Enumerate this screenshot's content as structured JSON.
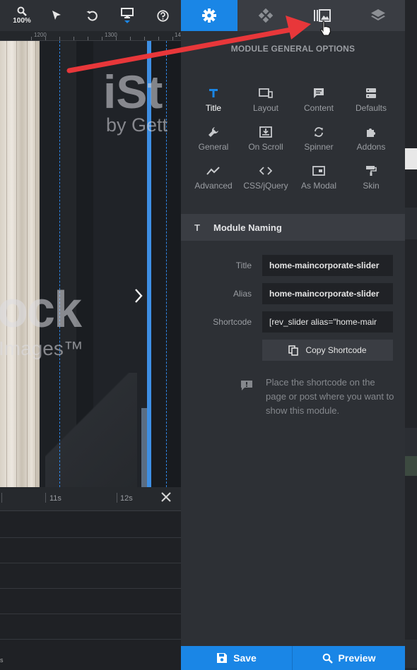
{
  "toolbar": {
    "zoom_label": "100%"
  },
  "ruler": {
    "labels": [
      "1200",
      "1300",
      "14"
    ]
  },
  "canvas": {
    "watermark_brand": "iSt",
    "watermark_sub": "by Gett",
    "watermark_stock": "ock",
    "watermark_images": "Images™"
  },
  "timeline": {
    "labels": [
      "11s",
      "12s"
    ]
  },
  "panel": {
    "title": "MODULE GENERAL OPTIONS",
    "options": [
      {
        "label": "Title",
        "icon": "title-icon"
      },
      {
        "label": "Layout",
        "icon": "layout-icon"
      },
      {
        "label": "Content",
        "icon": "content-icon"
      },
      {
        "label": "Defaults",
        "icon": "defaults-icon"
      },
      {
        "label": "General",
        "icon": "wrench-icon"
      },
      {
        "label": "On Scroll",
        "icon": "on-scroll-icon"
      },
      {
        "label": "Spinner",
        "icon": "spinner-icon"
      },
      {
        "label": "Addons",
        "icon": "puzzle-icon"
      },
      {
        "label": "Advanced",
        "icon": "advanced-icon"
      },
      {
        "label": "CSS/jQuery",
        "icon": "code-icon"
      },
      {
        "label": "As Modal",
        "icon": "modal-icon"
      },
      {
        "label": "Skin",
        "icon": "paint-roller-icon"
      }
    ],
    "active_option": "Title",
    "section": {
      "title": "Module Naming",
      "icon_glyph": "T"
    },
    "fields": {
      "title_label": "Title",
      "title_value": "home-maincorporate-slider",
      "alias_label": "Alias",
      "alias_value": "home-maincorporate-slider",
      "shortcode_label": "Shortcode",
      "shortcode_value": "[rev_slider alias=\"home-mair"
    },
    "copy_button": "Copy Shortcode",
    "info_text": "Place the shortcode on the page or post where you want to show this module.",
    "save_label": "Save",
    "preview_label": "Preview"
  },
  "colors": {
    "accent": "#1a86e6",
    "panel_bg": "#2d3035",
    "annotation_red": "#e8373a"
  }
}
